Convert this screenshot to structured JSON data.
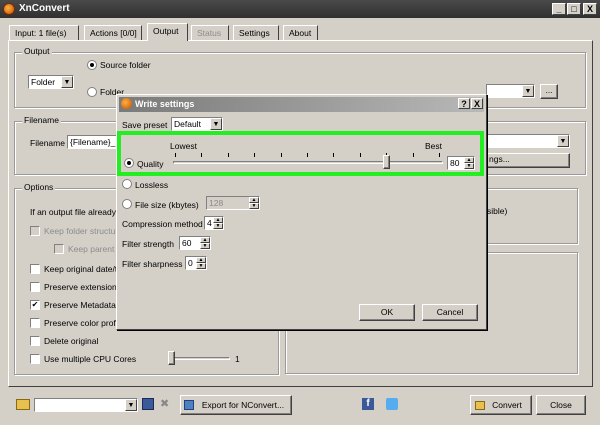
{
  "window": {
    "title": "XnConvert",
    "min": "_",
    "max": "□",
    "close": "X"
  },
  "tabs": [
    {
      "label": "Input: 1 file(s)"
    },
    {
      "label": "Actions [0/0]"
    },
    {
      "label": "Output"
    },
    {
      "label": "Status"
    },
    {
      "label": "Settings"
    },
    {
      "label": "About"
    }
  ],
  "output": {
    "group_label": "Output",
    "source_folder_label": "Source folder",
    "folder_radio_label": "Folder",
    "folder_combo_value": "Folder",
    "browse_label": "..."
  },
  "filename": {
    "group_label": "Filename",
    "label": "Filename",
    "value": "{Filename}_r",
    "format_settings_label": "ngs..."
  },
  "options": {
    "group_label": "Options",
    "if_exists_label": "If an output file already",
    "keep_folder_structure": "Keep folder structur",
    "keep_parent": "Keep parent",
    "keep_original_date": "Keep original date/t",
    "preserve_extension": "Preserve extension",
    "preserve_metadata": "Preserve Metadata",
    "preserve_color_profile": "Preserve color profi",
    "delete_original": "Delete original",
    "multi_cpu": "Use multiple CPU Cores",
    "cpu_value": "1",
    "right_partial": "sible)"
  },
  "dialog": {
    "title": "Write settings",
    "help": "?",
    "close": "X",
    "save_preset_label": "Save preset",
    "save_preset_value": "Default",
    "lowest_label": "Lowest",
    "best_label": "Best",
    "quality_label": "Quality",
    "quality_value": "80",
    "quality_fraction": 0.8,
    "lossless_label": "Lossless",
    "file_size_label": "File size (kbytes)",
    "file_size_value": "128",
    "compression_label": "Compression method",
    "compression_value": "4",
    "filter_strength_label": "Filter strength",
    "filter_strength_value": "60",
    "filter_sharpness_label": "Filter sharpness",
    "filter_sharpness_value": "0",
    "ok_label": "OK",
    "cancel_label": "Cancel"
  },
  "bottom": {
    "export_label": "Export for NConvert...",
    "convert_label": "Convert",
    "close_label": "Close",
    "social_facebook": "f"
  },
  "colors": {
    "highlight": "#22ee22",
    "facebook": "#3b5998",
    "twitter": "#55acee"
  }
}
